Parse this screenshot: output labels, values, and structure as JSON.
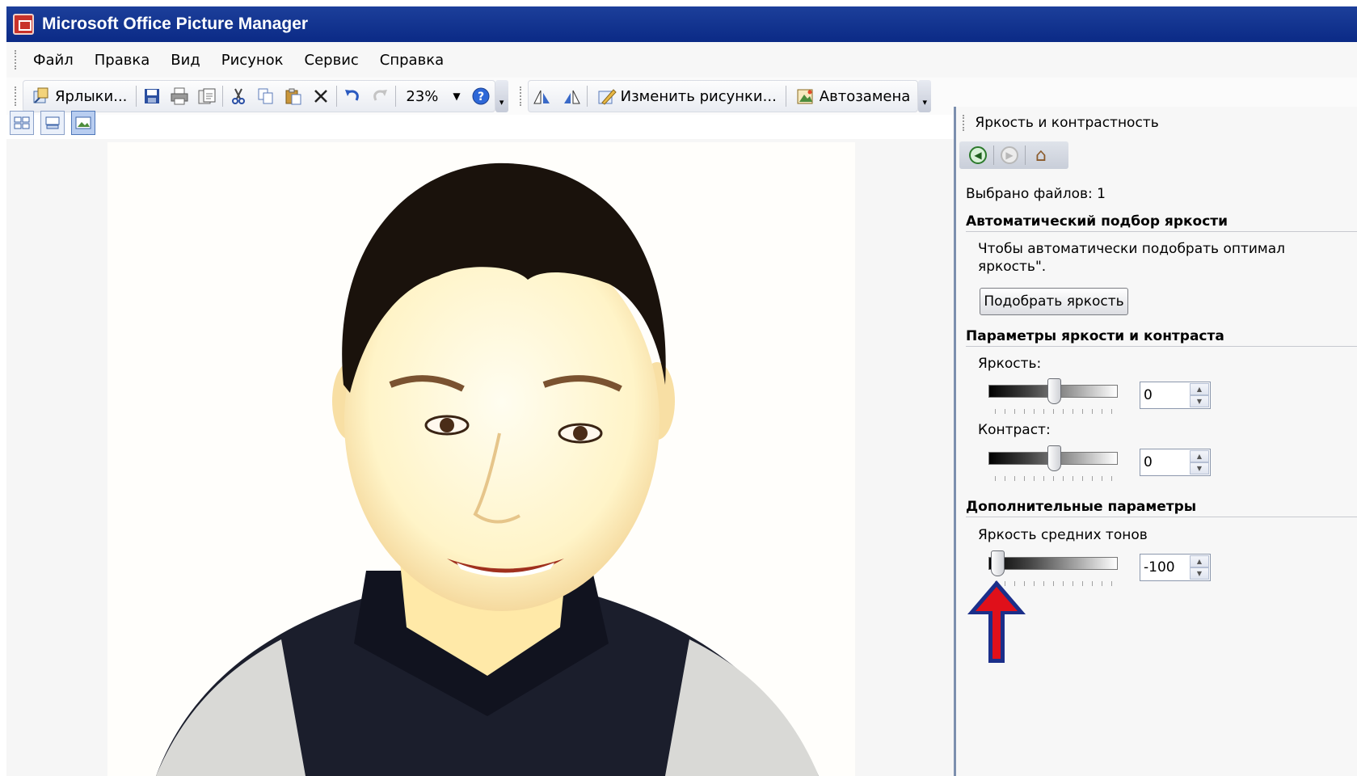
{
  "window": {
    "title": "Microsoft Office Picture Manager"
  },
  "menu": [
    {
      "label": "Файл"
    },
    {
      "label": "Правка"
    },
    {
      "label": "Вид"
    },
    {
      "label": "Рисунок"
    },
    {
      "label": "Сервис"
    },
    {
      "label": "Справка"
    }
  ],
  "toolbar": {
    "shortcuts_label": "Ярлыки...",
    "zoom_value": "23%",
    "edit_pictures_label": "Изменить рисунки...",
    "autocorrect_label": "Автозамена"
  },
  "taskpane": {
    "title": "Яркость и контрастность",
    "selected_files": "Выбрано файлов: 1",
    "auto_section": {
      "heading": "Автоматический подбор яркости",
      "description_line1": "Чтобы автоматически подобрать оптимал",
      "description_line2": "яркость\".",
      "button_label": "Подобрать яркость"
    },
    "params_section": {
      "heading": "Параметры яркости и контраста",
      "brightness": {
        "label": "Яркость:",
        "value": "0"
      },
      "contrast": {
        "label": "Контраст:",
        "value": "0"
      }
    },
    "extra_section": {
      "heading": "Дополнительные параметры",
      "midtones": {
        "label": "Яркость средних тонов",
        "value": "-100"
      }
    }
  },
  "colors": {
    "titlebar": "#0b2a86",
    "annotation_arrow": "#e0101a",
    "annotation_arrow_outline": "#1b2f8a"
  }
}
